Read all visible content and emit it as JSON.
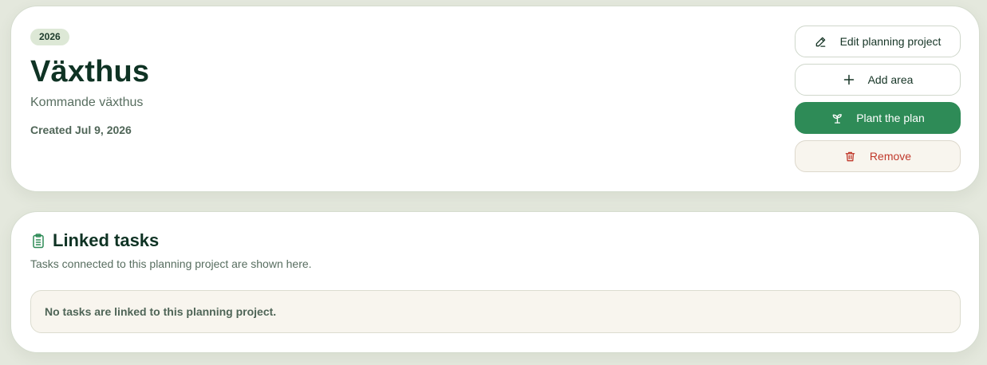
{
  "project": {
    "year": "2026",
    "title": "Växthus",
    "description": "Kommande växthus",
    "created": "Created Jul 9, 2026"
  },
  "actions": {
    "edit_label": "Edit planning project",
    "edit_icon": "pencil-icon",
    "add_area_label": "Add area",
    "add_area_icon": "plus-icon",
    "plant_label": "Plant the plan",
    "plant_icon": "sprout-icon",
    "remove_label": "Remove",
    "remove_icon": "trash-icon"
  },
  "linked_tasks": {
    "icon": "clipboard-icon",
    "title": "Linked tasks",
    "description": "Tasks connected to this planning project are shown here.",
    "empty_message": "No tasks are linked to this planning project."
  },
  "colors": {
    "accent": "#2e8b57",
    "danger": "#c0392b",
    "background": "#e4e8dd",
    "badge": "#dde8d6"
  }
}
